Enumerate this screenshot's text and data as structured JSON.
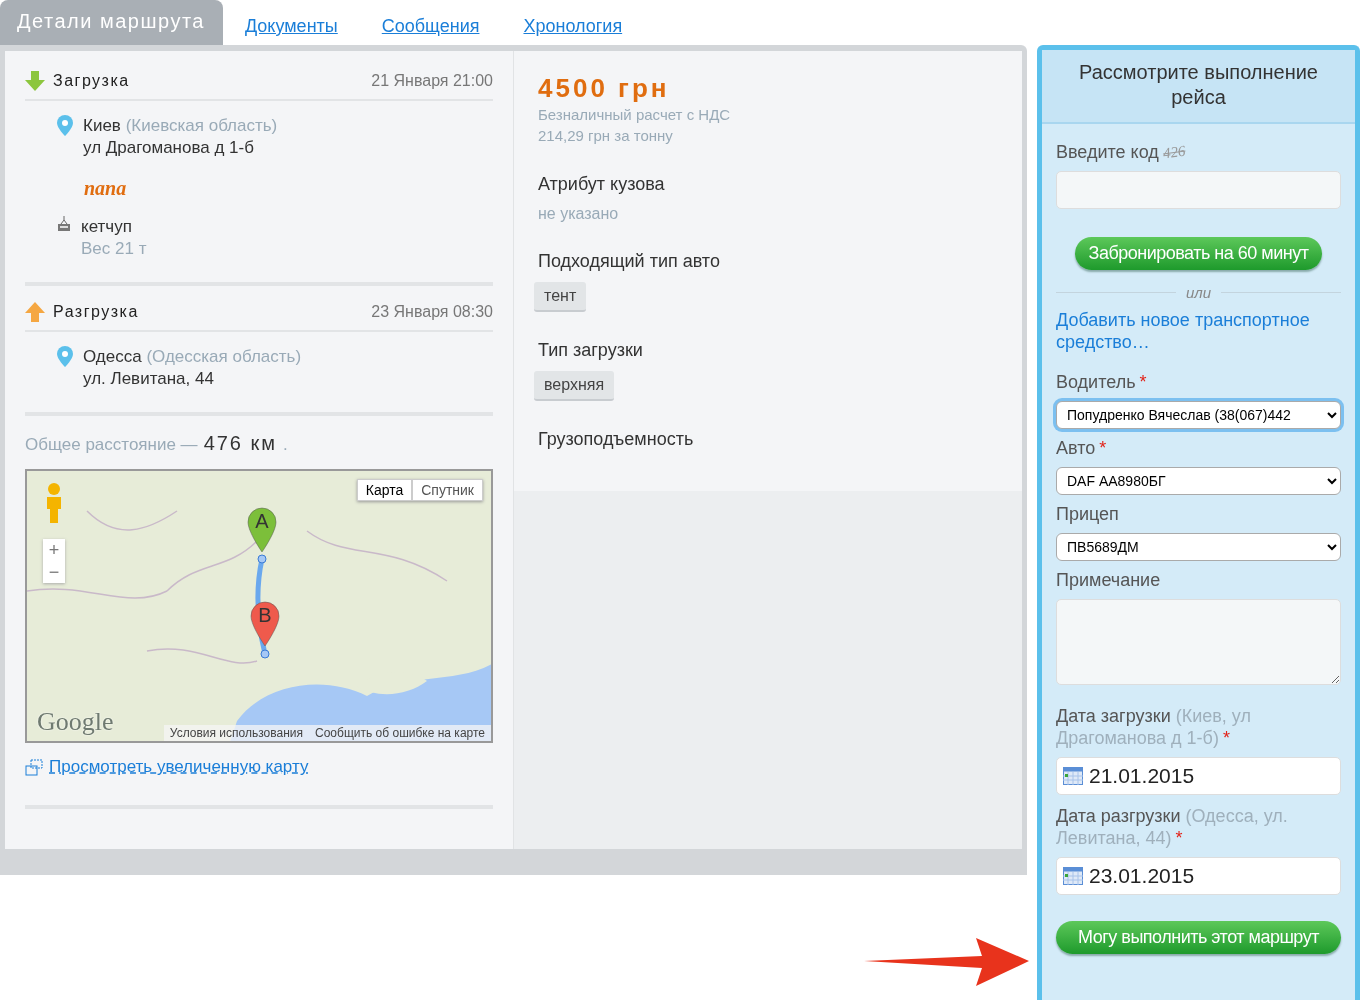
{
  "tabs": [
    {
      "label": "Детали маршрута",
      "selected": true
    },
    {
      "label": "Документы",
      "selected": false
    },
    {
      "label": "Сообщения",
      "selected": false
    },
    {
      "label": "Хронология",
      "selected": false
    }
  ],
  "route": {
    "stops": [
      {
        "kind": "loading",
        "title": "Загрузка",
        "datetime": "21 Января 21:00",
        "city": "Киев",
        "region": "(Киевская область)",
        "address": "ул Драгоманова д 1-б",
        "note": "папа",
        "cargo": "кетчуп",
        "weight": "Вес 21 т"
      },
      {
        "kind": "unloading",
        "title": "Разгрузка",
        "datetime": "23 Января 08:30",
        "city": "Одесса",
        "region": "(Одесская область)",
        "address": "ул. Левитана, 44"
      }
    ],
    "distance_label": "Общее расстояние —",
    "distance_value": "476 км",
    "distance_end": ".",
    "map": {
      "map_types": [
        {
          "label": "Карта",
          "selected": true
        },
        {
          "label": "Спутник",
          "selected": false
        }
      ],
      "zoom_in": "+",
      "zoom_out": "−",
      "marker_a": "A",
      "marker_b": "B",
      "logo": "Google",
      "footer_links": [
        "Условия использования",
        "Сообщить об ошибке на карте"
      ]
    },
    "map_link": "Просмотреть увеличенную карту"
  },
  "details": {
    "price": "4500 грн",
    "payment": "Безналичный расчет с НДС",
    "per_ton": "214,29 грн за тонну",
    "attributes": [
      {
        "kind": "text",
        "label": "Атрибут кузова",
        "value": "не указано"
      },
      {
        "kind": "tags",
        "label": "Подходящий тип авто",
        "tags": [
          "тент"
        ]
      },
      {
        "kind": "tags",
        "label": "Тип загрузки",
        "tags": [
          "верхняя"
        ]
      },
      {
        "kind": "label",
        "label": "Грузоподъемность"
      }
    ]
  },
  "side": {
    "title": "Рассмотрите выполнение рейса",
    "code_label": "Введите код",
    "captcha": "426",
    "book_button": "Забронировать на 60 минут",
    "separator": "или",
    "add_vehicle_link": "Добавить новое транспортное средство…",
    "fields": [
      {
        "kind": "select",
        "label": "Водитель",
        "required_mark": "*",
        "value": "Попудренко Вячеслав (38(067)442",
        "focused": true
      },
      {
        "kind": "select",
        "label": "Авто",
        "required_mark": "*",
        "value": "DAF АА8980БГ",
        "focused": false
      },
      {
        "kind": "select",
        "label": "Прицеп",
        "value": "ПВ5689ДМ",
        "focused": false
      },
      {
        "kind": "textarea",
        "label": "Примечание",
        "focused": false
      },
      {
        "kind": "date",
        "label": "Дата загрузки",
        "hint": "(Киев, ул Драгоманова д 1-б)",
        "required_mark": "*",
        "value": "21.01.2015",
        "focused": false
      },
      {
        "kind": "date",
        "label": "Дата разгрузки",
        "hint": "(Одесса, ул. Левитана, 44)",
        "required_mark": "*",
        "value": "23.01.2015",
        "focused": false
      }
    ],
    "submit_button": "Могу выполнить этот маршрут"
  }
}
